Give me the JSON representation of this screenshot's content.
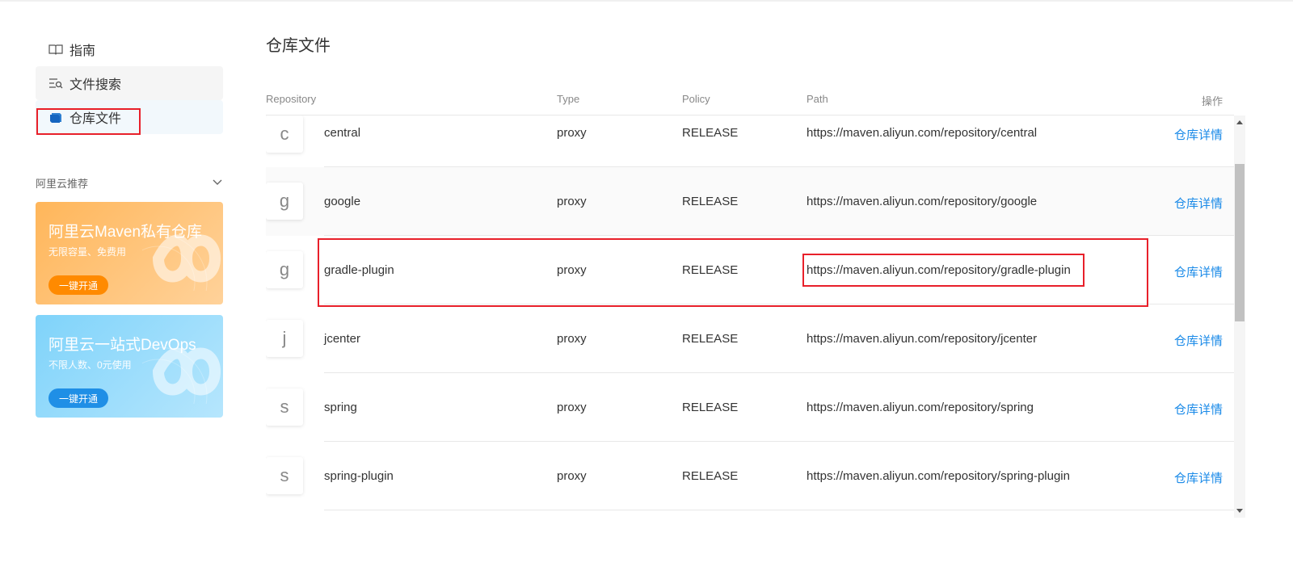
{
  "sidebar": {
    "items": [
      {
        "label": "指南",
        "icon": "book-icon"
      },
      {
        "label": "文件搜索",
        "icon": "search-list-icon"
      },
      {
        "label": "仓库文件",
        "icon": "repository-icon"
      }
    ],
    "recommend_title": "阿里云推荐",
    "promos": [
      {
        "title": "阿里云Maven私有仓库",
        "subtitle": "无限容量、免费用",
        "button": "一键开通",
        "color": "#ff8a00"
      },
      {
        "title": "阿里云一站式DevOps",
        "subtitle": "不限人数、0元使用",
        "button": "一键开通",
        "color": "#1f8fe6"
      }
    ]
  },
  "main": {
    "title": "仓库文件",
    "columns": [
      "Repository",
      "Type",
      "Policy",
      "Path",
      "操作"
    ],
    "rows": [
      {
        "avatar": "c",
        "name": "central",
        "type": "proxy",
        "policy": "RELEASE",
        "path": "https://maven.aliyun.com/repository/central",
        "action": "仓库详情"
      },
      {
        "avatar": "g",
        "name": "google",
        "type": "proxy",
        "policy": "RELEASE",
        "path": "https://maven.aliyun.com/repository/google",
        "action": "仓库详情"
      },
      {
        "avatar": "g",
        "name": "gradle-plugin",
        "type": "proxy",
        "policy": "RELEASE",
        "path": "https://maven.aliyun.com/repository/gradle-plugin",
        "action": "仓库详情"
      },
      {
        "avatar": "j",
        "name": "jcenter",
        "type": "proxy",
        "policy": "RELEASE",
        "path": "https://maven.aliyun.com/repository/jcenter",
        "action": "仓库详情"
      },
      {
        "avatar": "s",
        "name": "spring",
        "type": "proxy",
        "policy": "RELEASE",
        "path": "https://maven.aliyun.com/repository/spring",
        "action": "仓库详情"
      },
      {
        "avatar": "s",
        "name": "spring-plugin",
        "type": "proxy",
        "policy": "RELEASE",
        "path": "https://maven.aliyun.com/repository/spring-plugin",
        "action": "仓库详情"
      }
    ]
  },
  "colors": {
    "link": "#1a8ae8",
    "annotation": "#e8202a"
  }
}
